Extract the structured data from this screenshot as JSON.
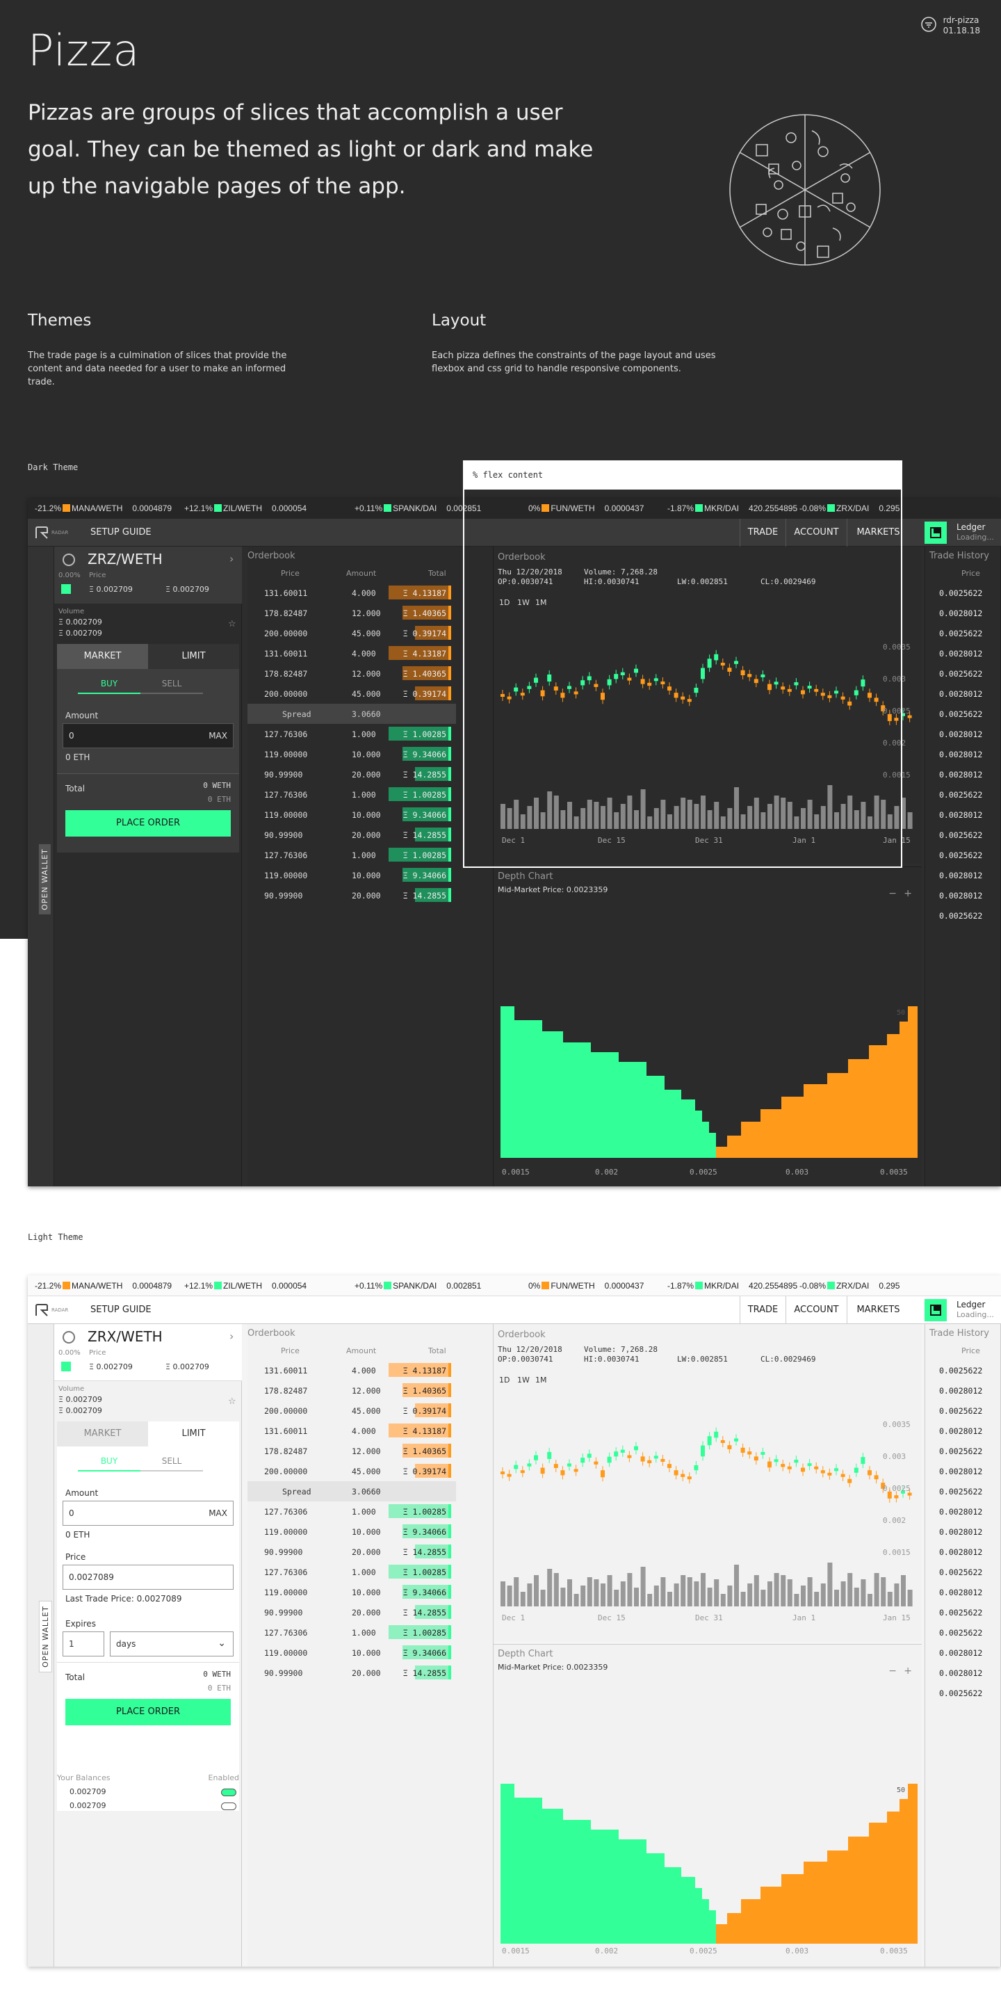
{
  "version": {
    "repo": "rdr-pizza",
    "date": "01.18.18"
  },
  "title": "Pizza",
  "intro": "Pizzas are groups of slices that accomplish a user goal. They can be themed as light or dark and make up the navigable pages of the app.",
  "themes": {
    "heading": "Themes",
    "body": "The trade page is a culmination of slices that provide the content and data needed for a user to make an informed trade."
  },
  "layout": {
    "heading": "Layout",
    "body": "Each pizza defines the constraints of the page layout and uses flexbox and css grid to handle responsive components."
  },
  "labels": {
    "dark": "Dark Theme",
    "light": "Light Theme",
    "flex": "% flex content"
  },
  "colors": {
    "green": "#33ff99",
    "orange": "#ff9a1a",
    "dark_bg": "#2b2b2b",
    "light_bg": "#f4f4f4"
  },
  "ticker": [
    {
      "pct": "-21.2%",
      "up": false,
      "pair": "MANA/WETH",
      "price": "0.0004879"
    },
    {
      "pct": "+12.1%",
      "up": true,
      "pair": "ZIL/WETH",
      "price": "0.000054"
    },
    {
      "pct": "+0.11%",
      "up": true,
      "pair": "SPANK/DAI",
      "price": "0.002851"
    },
    {
      "pct": "0%",
      "up": false,
      "pair": "FUN/WETH",
      "price": "0.0000437"
    },
    {
      "pct": "-1.87%",
      "up": true,
      "pair": "MKR/DAI",
      "price": "420.2554895"
    },
    {
      "pct": "-0.08%",
      "up": true,
      "pair": "ZRX/DAI",
      "price": "0.295"
    }
  ],
  "nav": {
    "brand": "RADAR",
    "setup": "SETUP GUIDE",
    "trade": "TRADE",
    "account": "ACCOUNT",
    "markets": "MARKETS",
    "ledger": "Ledger",
    "ledger_status": "Loading..."
  },
  "wallet": {
    "label": "OPEN WALLET"
  },
  "pair_dark": "ZRZ/WETH",
  "pair_light": "ZRX/WETH",
  "order": {
    "change": "0.00%",
    "price_label": "Price",
    "bid": "Ξ 0.002709",
    "ask": "Ξ 0.002709",
    "volume_label": "Volume",
    "vol1": "Ξ 0.002709",
    "vol2": "Ξ 0.002709",
    "market": "MARKET",
    "limit": "LIMIT",
    "buy": "BUY",
    "sell": "SELL",
    "amount_label": "Amount",
    "amount_value": "0",
    "max": "MAX",
    "amount_eth": "0 ETH",
    "price_field_label": "Price",
    "price_value": "0.0027089",
    "last_trade": "Last Trade Price: 0.0027089",
    "expires_label": "Expires",
    "expires_value": "1",
    "expires_unit": "days",
    "total_label": "Total",
    "total_weth": "0 WETH",
    "total_eth": "0 ETH",
    "place": "PLACE ORDER",
    "balances_label": "Your Balances",
    "enabled_label": "Enabled",
    "bal1": "0.002709",
    "bal2": "0.002709"
  },
  "orderbook": {
    "title": "Orderbook",
    "col_price": "Price",
    "col_amount": "Amount",
    "col_total": "Total",
    "asks": [
      {
        "price": "131.60011",
        "amount": "4.000",
        "total": "Ξ 4.13187",
        "fill": 0.9
      },
      {
        "price": "178.82487",
        "amount": "12.000",
        "total": "Ξ 1.40365",
        "fill": 0.45
      },
      {
        "price": "200.00000",
        "amount": "45.000",
        "total": "Ξ 0.39174",
        "fill": 0.05
      },
      {
        "price": "131.60011",
        "amount": "4.000",
        "total": "Ξ 4.13187",
        "fill": 0.9
      },
      {
        "price": "178.82487",
        "amount": "12.000",
        "total": "Ξ 1.40365",
        "fill": 0.45
      },
      {
        "price": "200.00000",
        "amount": "45.000",
        "total": "Ξ 0.39174",
        "fill": 0.05
      }
    ],
    "spread_label": "Spread",
    "spread_value": "3.0660",
    "bids": [
      {
        "price": "127.76306",
        "amount": "1.000",
        "total": "Ξ 1.00285",
        "fill": 0.9
      },
      {
        "price": "119.00000",
        "amount": "10.000",
        "total": "Ξ 9.34066",
        "fill": 0.45
      },
      {
        "price": "90.99900",
        "amount": "20.000",
        "total": "Ξ 14.2855",
        "fill": 0.05
      },
      {
        "price": "127.76306",
        "amount": "1.000",
        "total": "Ξ 1.00285",
        "fill": 0.9
      },
      {
        "price": "119.00000",
        "amount": "10.000",
        "total": "Ξ 9.34066",
        "fill": 0.45
      },
      {
        "price": "90.99900",
        "amount": "20.000",
        "total": "Ξ 14.2855",
        "fill": 0.05
      },
      {
        "price": "127.76306",
        "amount": "1.000",
        "total": "Ξ 1.00285",
        "fill": 0.9
      },
      {
        "price": "119.00000",
        "amount": "10.000",
        "total": "Ξ 9.34066",
        "fill": 0.45
      },
      {
        "price": "90.99900",
        "amount": "20.000",
        "total": "Ξ 14.2855",
        "fill": 0.05
      }
    ]
  },
  "price_chart": {
    "title": "Orderbook",
    "info_date": "Thu 12/20/2018",
    "info_volume": "Volume: 7,268.28",
    "info_op": "OP:0.0030741",
    "info_hi": "HI:0.0030741",
    "info_lw": "LW:0.002851",
    "info_cl": "CL:0.0029469",
    "ranges": [
      "1D",
      "1W",
      "1M"
    ],
    "y_ticks": [
      "0.0035",
      "0.003",
      "0.0025",
      "0.002",
      "0.0015"
    ],
    "x_ticks": [
      "Dec 1",
      "Dec 15",
      "Dec 31",
      "Jan 1",
      "Jan 15"
    ]
  },
  "depth_chart": {
    "title": "Depth Chart",
    "mid": "Mid-Market Price: 0.0023359",
    "zoom_out": "−",
    "zoom_in": "+",
    "x_ticks": [
      "0.0015",
      "0.002",
      "0.0025",
      "0.003",
      "0.0035"
    ],
    "y_ticks": [
      "50",
      "",
      "",
      "",
      "",
      ""
    ]
  },
  "history": {
    "title": "Trade History",
    "col_price": "Price",
    "rows": [
      {
        "price": "0.0025622",
        "side": "buy"
      },
      {
        "price": "0.0028012",
        "side": "sell"
      },
      {
        "price": "0.0025622",
        "side": "sell"
      },
      {
        "price": "0.0028012",
        "side": "sell"
      },
      {
        "price": "0.0025622",
        "side": "buy"
      },
      {
        "price": "0.0028012",
        "side": "sell"
      },
      {
        "price": "0.0025622",
        "side": "buy"
      },
      {
        "price": "0.0028012",
        "side": "sell"
      },
      {
        "price": "0.0028012",
        "side": "sell"
      },
      {
        "price": "0.0028012",
        "side": "sell"
      },
      {
        "price": "0.0025622",
        "side": "buy"
      },
      {
        "price": "0.0028012",
        "side": "buy"
      },
      {
        "price": "0.0025622",
        "side": "buy"
      },
      {
        "price": "0.0025622",
        "side": "buy"
      },
      {
        "price": "0.0028012",
        "side": "sell"
      },
      {
        "price": "0.0028012",
        "side": "sell"
      },
      {
        "price": "0.0025622",
        "side": "buy"
      }
    ]
  }
}
